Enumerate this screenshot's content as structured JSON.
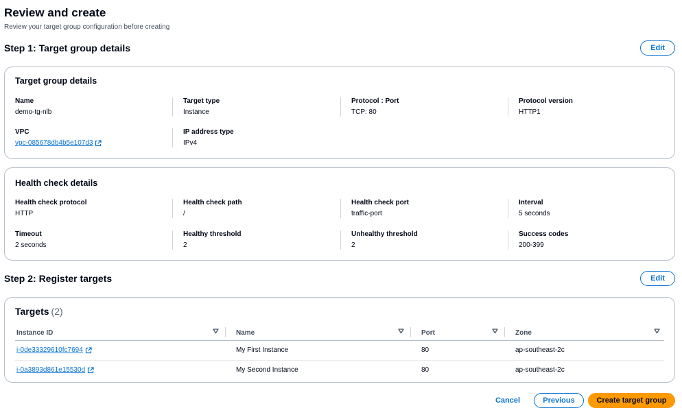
{
  "page": {
    "title": "Review and create",
    "subtitle": "Review your target group configuration before creating"
  },
  "step1": {
    "title": "Step 1: Target group details",
    "edit_label": "Edit",
    "card_title": "Target group details",
    "fields": {
      "name": {
        "label": "Name",
        "value": "demo-tg-nlb"
      },
      "target_type": {
        "label": "Target type",
        "value": "Instance"
      },
      "protocol_port": {
        "label": "Protocol : Port",
        "value": "TCP: 80"
      },
      "protocol_version": {
        "label": "Protocol version",
        "value": "HTTP1"
      },
      "vpc": {
        "label": "VPC",
        "value": "vpc-085678db4b5e107d3"
      },
      "ip_type": {
        "label": "IP address type",
        "value": "IPv4"
      }
    }
  },
  "health": {
    "card_title": "Health check details",
    "fields": {
      "protocol": {
        "label": "Health check protocol",
        "value": "HTTP"
      },
      "path": {
        "label": "Health check path",
        "value": "/"
      },
      "port": {
        "label": "Health check port",
        "value": "traffic-port"
      },
      "interval": {
        "label": "Interval",
        "value": "5 seconds"
      },
      "timeout": {
        "label": "Timeout",
        "value": "2 seconds"
      },
      "healthy": {
        "label": "Healthy threshold",
        "value": "2"
      },
      "unhealthy": {
        "label": "Unhealthy threshold",
        "value": "2"
      },
      "success": {
        "label": "Success codes",
        "value": "200-399"
      }
    }
  },
  "step2": {
    "title": "Step 2: Register targets",
    "edit_label": "Edit",
    "targets_title": "Targets",
    "targets_count": "(2)",
    "columns": [
      "Instance ID",
      "Name",
      "Port",
      "Zone"
    ],
    "rows": [
      {
        "instance_id": "i-0de33329610fc7694",
        "name": "My First Instance",
        "port": "80",
        "zone": "ap-southeast-2c"
      },
      {
        "instance_id": "i-0a3893d861e15530d",
        "name": "My Second Instance",
        "port": "80",
        "zone": "ap-southeast-2c"
      }
    ]
  },
  "footer": {
    "cancel_label": "Cancel",
    "previous_label": "Previous",
    "create_label": "Create target group"
  },
  "colors": {
    "link": "#0972d3",
    "primary_button": "#ff9900",
    "border": "#b6bec9"
  },
  "icons": {
    "external_link": "external-link-icon",
    "sort": "caret-down-icon"
  }
}
